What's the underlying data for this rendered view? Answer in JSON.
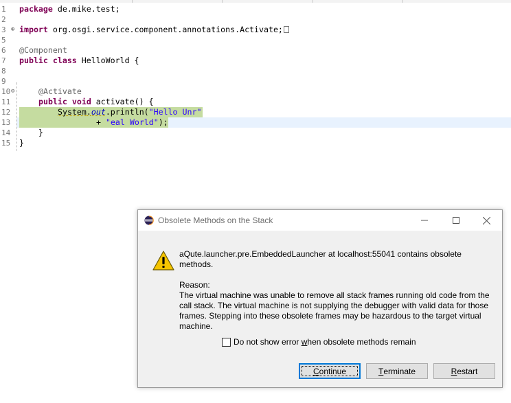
{
  "editor": {
    "line_numbers": [
      "1",
      "2",
      "3",
      "5",
      "6",
      "7",
      "8",
      "9",
      "10",
      "11",
      "12",
      "13",
      "14",
      "15"
    ],
    "fold_markers": {
      "line3": "⊕",
      "line10": "⊖"
    },
    "line1": {
      "kw": "package",
      "rest": " de.mike.test;"
    },
    "line3": {
      "kw": "import",
      "rest": " org.osgi.service.component.annotations.Activate;"
    },
    "line6": "@Component",
    "line7": {
      "kw1": "public",
      "kw2": "class",
      "rest": " HelloWorld {"
    },
    "line10": "@Activate",
    "line11": {
      "kw1": "public",
      "kw2": "void",
      "rest": " activate() {"
    },
    "line12": {
      "cls": "System",
      "dot": ".",
      "field": "out",
      "call": ".println(",
      "str": "\"Hello Unr\""
    },
    "line13": {
      "plus": "+ ",
      "str": "\"eal World\"",
      "end": ");"
    },
    "line14": "}",
    "line15": "}"
  },
  "dialog": {
    "title": "Obsolete Methods on the Stack",
    "message_lines": [
      "aQute.launcher.pre.EmbeddedLauncher at localhost:55041 contains obsolete",
      "methods."
    ],
    "reason_label": "Reason:",
    "reason_lines": [
      "The virtual machine was unable to remove all stack frames running old code from the",
      "call stack. The virtual machine is not supplying the debugger with valid data for those",
      "frames. Stepping into these obsolete frames may be hazardous to the target virtual",
      "machine."
    ],
    "checkbox": {
      "label_pre": "Do not show error ",
      "label_mn": "w",
      "label_post": "hen obsolete methods remain",
      "checked": false
    },
    "buttons": {
      "continue": {
        "mn": "C",
        "rest": "ontinue"
      },
      "terminate": {
        "mn": "T",
        "rest": "erminate"
      },
      "restart": {
        "mn": "R",
        "rest": "estart"
      }
    }
  },
  "colors": {
    "keyword": "#7f0055",
    "string": "#2a00ff",
    "debug_highlight": "#c5dca0",
    "current_line": "#e8f2fe",
    "focus_accent": "#0078d7"
  },
  "icons": [
    "eclipse-icon",
    "minimize-icon",
    "maximize-icon",
    "close-icon",
    "warning-icon"
  ]
}
